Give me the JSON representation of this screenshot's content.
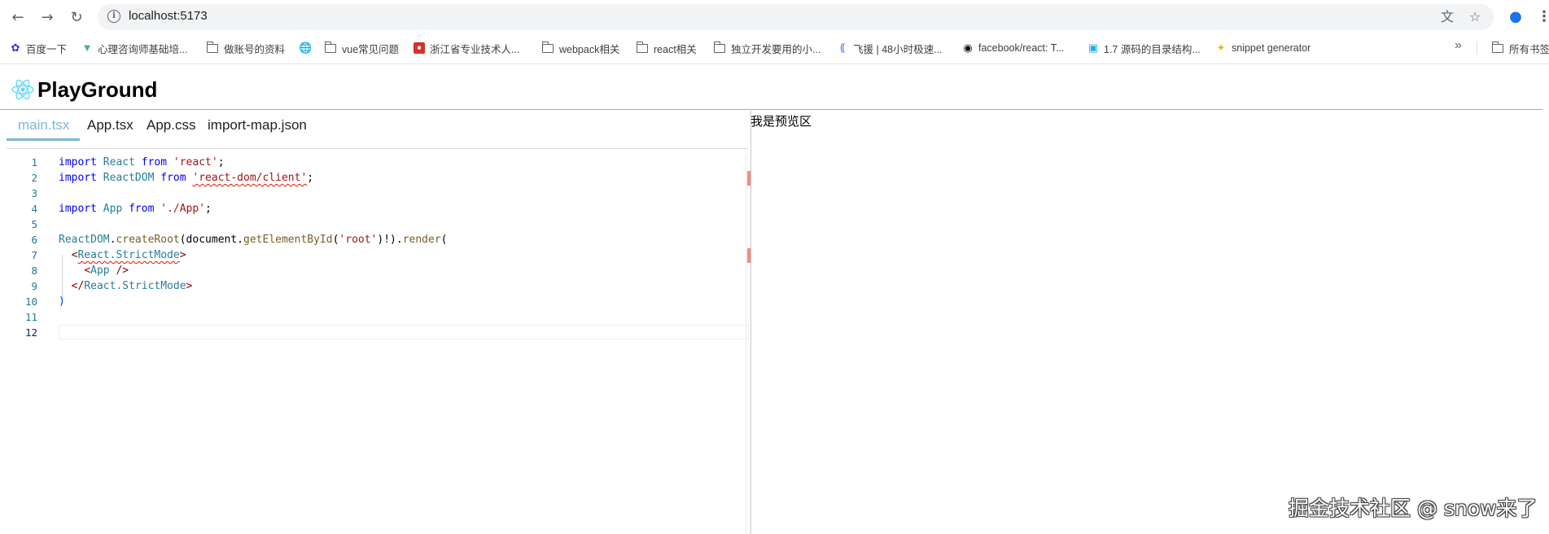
{
  "browser": {
    "url": "localhost:5173",
    "icons": {
      "back": "arrow-left-icon",
      "forward": "arrow-right-icon",
      "reload": "reload-icon",
      "site_info": "info-icon",
      "translate": "translate-icon",
      "bookmark_star": "star-icon",
      "profile": "profile-icon",
      "menu": "kebab-menu-icon"
    }
  },
  "bookmarks": {
    "items": [
      {
        "label": "百度一下",
        "icon": "baidu-paw-icon"
      },
      {
        "label": "心理咨询师基础培...",
        "icon": "vue-logo-icon"
      },
      {
        "label": "做账号的资料",
        "icon": "folder-icon"
      },
      {
        "label": "",
        "icon": "globe-icon"
      },
      {
        "label": "vue常见问题",
        "icon": "folder-icon"
      },
      {
        "label": "浙江省专业技术人...",
        "icon": "red-badge-icon"
      },
      {
        "label": "webpack相关",
        "icon": "folder-icon"
      },
      {
        "label": "react相关",
        "icon": "folder-icon"
      },
      {
        "label": "独立开发要用的小...",
        "icon": "folder-icon"
      },
      {
        "label": "飞援 | 48小时极速...",
        "icon": "feiyuan-icon"
      },
      {
        "label": "facebook/react: T...",
        "icon": "github-icon"
      },
      {
        "label": "1.7 源码的目录结构...",
        "icon": "bilibili-icon"
      },
      {
        "label": "snippet generator",
        "icon": "snippet-icon"
      }
    ],
    "overflow": "»",
    "all_bookmarks": "所有书签"
  },
  "app": {
    "title": "PlayGround",
    "logo": "react-logo-icon",
    "accent": "#7cb6d6"
  },
  "tabs": [
    {
      "label": "main.tsx",
      "active": true
    },
    {
      "label": "App.tsx",
      "active": false
    },
    {
      "label": "App.css",
      "active": false
    },
    {
      "label": "import-map.json",
      "active": false
    }
  ],
  "editor": {
    "current_line": 12,
    "lines": [
      {
        "n": "1",
        "text": "import React from 'react';"
      },
      {
        "n": "2",
        "text": "import ReactDOM from 'react-dom/client';"
      },
      {
        "n": "3",
        "text": ""
      },
      {
        "n": "4",
        "text": "import App from './App';"
      },
      {
        "n": "5",
        "text": ""
      },
      {
        "n": "6",
        "text": "ReactDOM.createRoot(document.getElementById('root')!).render("
      },
      {
        "n": "7",
        "text": "  <React.StrictMode>"
      },
      {
        "n": "8",
        "text": "    <App />"
      },
      {
        "n": "9",
        "text": "  </React.StrictMode>"
      },
      {
        "n": "10",
        "text": ")"
      },
      {
        "n": "11",
        "text": ""
      },
      {
        "n": "12",
        "text": ""
      }
    ]
  },
  "preview": {
    "text": "我是预览区"
  },
  "watermark": "掘金技术社区 @ snow来了"
}
